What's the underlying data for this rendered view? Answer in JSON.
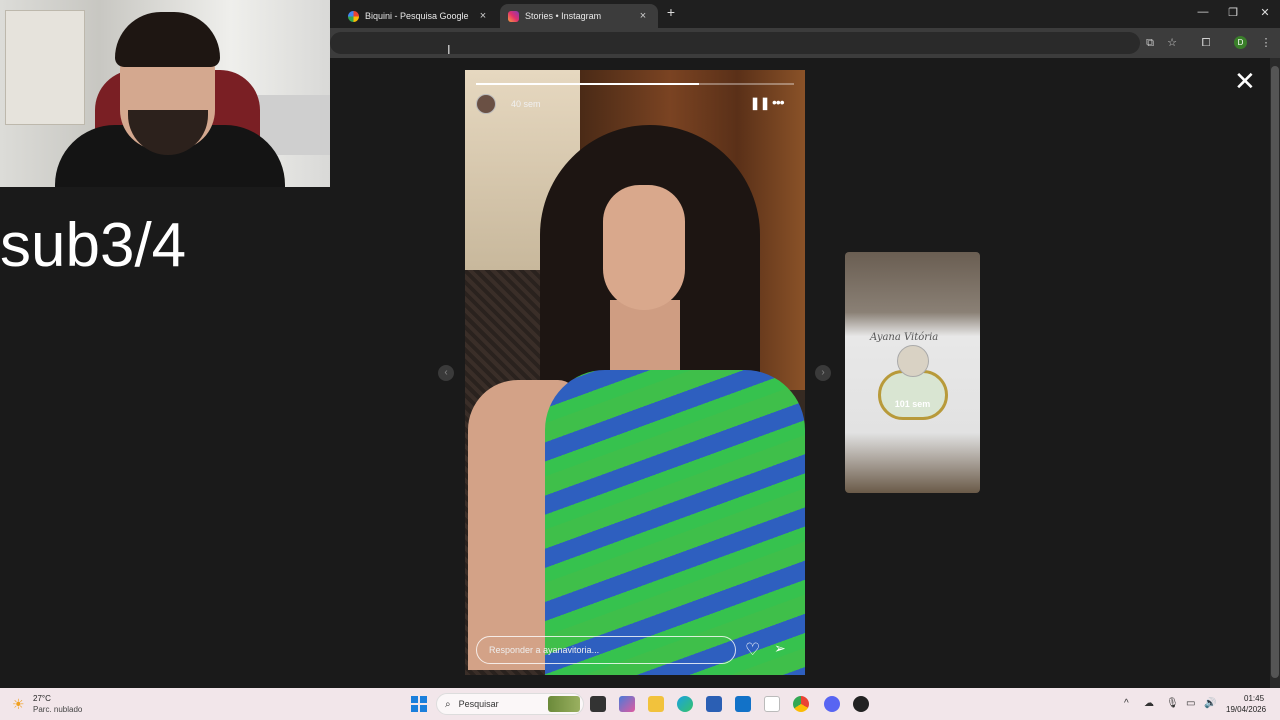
{
  "browser": {
    "tabs": [
      {
        "title": "Biquini - Pesquisa Google",
        "favicon": "google-icon"
      },
      {
        "title": "Stories • Instagram",
        "favicon": "instagram-icon",
        "active": true
      }
    ],
    "new_tab": "+",
    "close_tab": "×",
    "window_controls": {
      "minimize": "—",
      "maximize": "❐",
      "close": "✕"
    },
    "profile_initial": "D"
  },
  "overlay_text": "sub3/4",
  "story": {
    "time": "40 sem",
    "progress_fraction": 0.7,
    "reply_placeholder": "Responder a ayanavitoria...",
    "pause_icon": "pause-icon",
    "more_icon": "more-icon"
  },
  "next_story": {
    "time": "101 sem",
    "shirt_text": "Ayana Vitória"
  },
  "taskbar": {
    "weather_temp": "27°C",
    "weather_desc": "Parc. nublado",
    "search_placeholder": "Pesquisar",
    "time": "01:45",
    "date": "19/04/2026"
  },
  "colors": {
    "accent_instagram": "#e1306c",
    "windows_blue": "#1a7fdc"
  }
}
